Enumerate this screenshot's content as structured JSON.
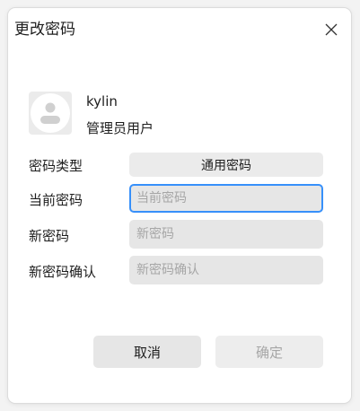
{
  "dialog": {
    "title": "更改密码",
    "close_icon": "close-icon"
  },
  "user": {
    "avatar_icon": "user-avatar-icon",
    "name": "kylin",
    "type": "管理员用户"
  },
  "form": {
    "password_type_label": "密码类型",
    "password_type_value": "通用密码",
    "current_password_label": "当前密码",
    "current_password_placeholder": "当前密码",
    "new_password_label": "新密码",
    "new_password_placeholder": "新密码",
    "confirm_password_label": "新密码确认",
    "confirm_password_placeholder": "新密码确认"
  },
  "buttons": {
    "cancel": "取消",
    "confirm": "确定"
  },
  "colors": {
    "focus_accent": "#3790fa",
    "disabled_text": "#a6a6a6"
  }
}
